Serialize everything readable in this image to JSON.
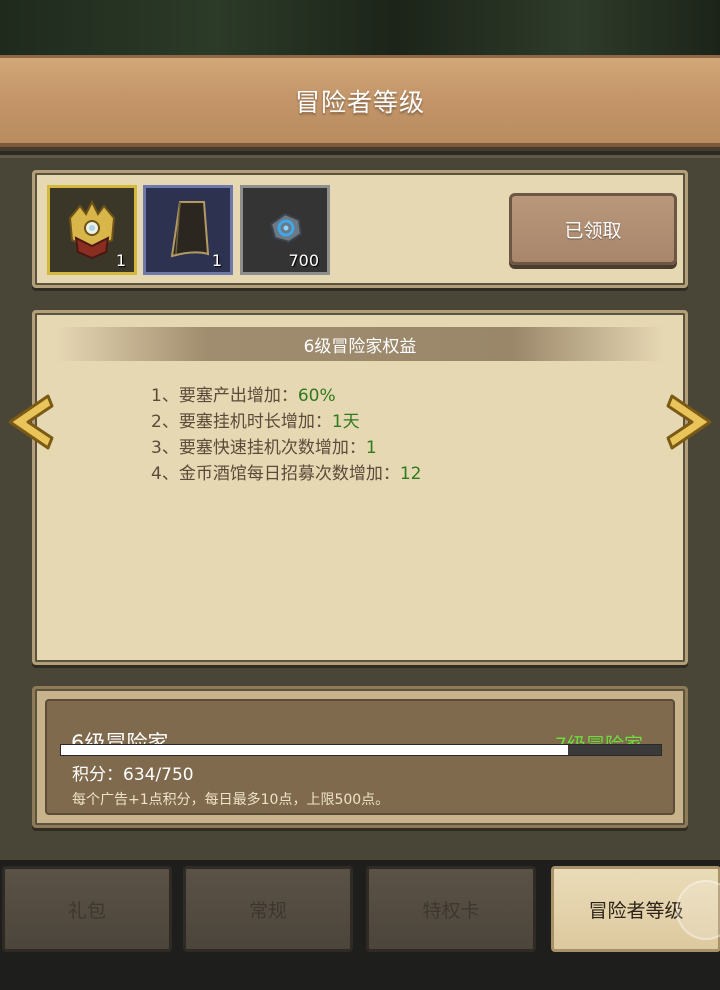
{
  "title": "冒险者等级",
  "reward": {
    "items": [
      {
        "icon": "gold-helmet-icon",
        "count": "1"
      },
      {
        "icon": "cloak-icon",
        "count": "1"
      },
      {
        "icon": "gem-icon",
        "count": "700"
      }
    ],
    "claim_label": "已领取"
  },
  "benefits": {
    "title": "6级冒险家权益",
    "lines": [
      {
        "text": "1、要塞产出增加：",
        "value": "60%"
      },
      {
        "text": "2、要塞挂机时长增加：",
        "value": "1天"
      },
      {
        "text": "3、要塞快速挂机次数增加：",
        "value": "1"
      },
      {
        "text": "4、金币酒馆每日招募次数增加：",
        "value": "12"
      }
    ]
  },
  "level": {
    "current": "6级冒险家",
    "next": "7级冒险家",
    "points_text": "积分：634/750",
    "progress": 0.845,
    "note": "每个广告+1点积分，每日最多10点，上限500点。"
  },
  "tabs": [
    "礼包",
    "常规",
    "特权卡",
    "冒险者等级"
  ],
  "colors": {
    "value_green": "#2e7a1c",
    "next_level_green": "#6ddc3c",
    "panel": "#e7d8b4",
    "title_bar": "#c4966a"
  }
}
